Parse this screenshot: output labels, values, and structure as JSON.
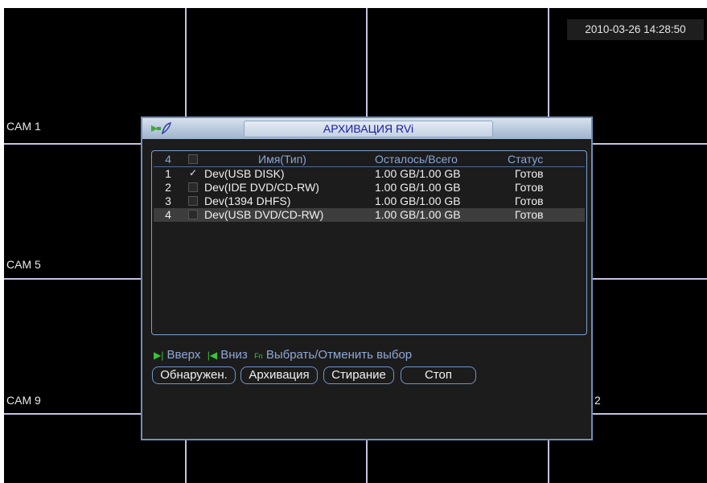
{
  "overlay": {
    "clock": "2010-03-26 14:28:50",
    "cameras": [
      "CAM 1",
      "CAM 5",
      "CAM 9"
    ],
    "partial_label": "2"
  },
  "dialog": {
    "title": "АРХИВАЦИЯ RVi",
    "table": {
      "headers": {
        "count": "4",
        "name": "Имя(Тип)",
        "space": "Осталось/Всего",
        "status": "Статус"
      },
      "rows": [
        {
          "num": "1",
          "checked": true,
          "name": "Dev(USB DISK)",
          "space": "1.00 GB/1.00 GB",
          "status": "Готов"
        },
        {
          "num": "2",
          "checked": false,
          "name": "Dev(IDE DVD/CD-RW)",
          "space": "1.00 GB/1.00 GB",
          "status": "Готов"
        },
        {
          "num": "3",
          "checked": false,
          "name": "Dev(1394 DHFS)",
          "space": "1.00 GB/1.00 GB",
          "status": "Готов"
        },
        {
          "num": "4",
          "checked": false,
          "name": "Dev(USB DVD/CD-RW)",
          "space": "1.00 GB/1.00 GB",
          "status": "Готов"
        }
      ],
      "selected_row": 4,
      "check_mark": "✓"
    },
    "legend": {
      "up_key": "▶|",
      "up": "Вверх",
      "down_key": "|◀",
      "down": "Вниз",
      "fn_key": "Fn",
      "select": "Выбрать/Отменить выбор"
    },
    "buttons": {
      "detect": "Обнаружен.",
      "backup": "Архивация",
      "erase": "Стирание",
      "stop": "Стоп"
    }
  },
  "colors": {
    "grid": "#c9c0e4",
    "title_text": "#1a1aa8",
    "accent": "#6f95cf",
    "key_hint": "#3ac43a"
  }
}
